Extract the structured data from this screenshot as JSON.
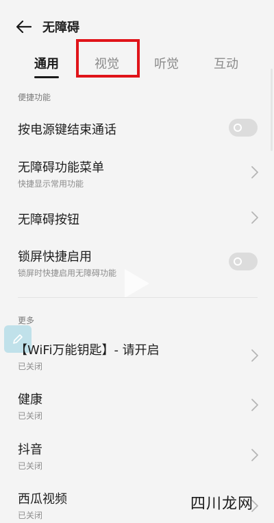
{
  "header": {
    "title": "无障碍",
    "back_icon": "arrow-left-icon"
  },
  "tabs": [
    {
      "label": "通用",
      "active": true
    },
    {
      "label": "视觉",
      "active": false
    },
    {
      "label": "听觉",
      "active": false
    },
    {
      "label": "互动",
      "active": false
    }
  ],
  "sections": {
    "shortcut_label": "便捷功能",
    "more_label": "更多"
  },
  "shortcut_items": [
    {
      "title": "按电源键结束通话",
      "subtitle": "",
      "control": "toggle",
      "on": false
    },
    {
      "title": "无障碍功能菜单",
      "subtitle": "快捷显示常用功能",
      "control": "chevron"
    },
    {
      "title": "无障碍按钮",
      "subtitle": "",
      "control": "chevron"
    },
    {
      "title": "锁屏快捷启用",
      "subtitle": "锁屏时快捷启用无障碍功能",
      "control": "toggle",
      "on": false
    }
  ],
  "more_items": [
    {
      "title": "【WiFi万能钥匙】- 请开启",
      "subtitle": "已关闭",
      "control": "chevron"
    },
    {
      "title": "健康",
      "subtitle": "已关闭",
      "control": "chevron"
    },
    {
      "title": "抖音",
      "subtitle": "已关闭",
      "control": "chevron"
    },
    {
      "title": "西瓜视频",
      "subtitle": "已关闭",
      "control": "chevron"
    }
  ],
  "watermark": {
    "text": "四川龙网"
  },
  "colors": {
    "background": "#f4f4f4",
    "highlight_box": "#e0141a",
    "toggle_off": "#dcdcdc",
    "secondary_text": "#8c8c8c"
  }
}
